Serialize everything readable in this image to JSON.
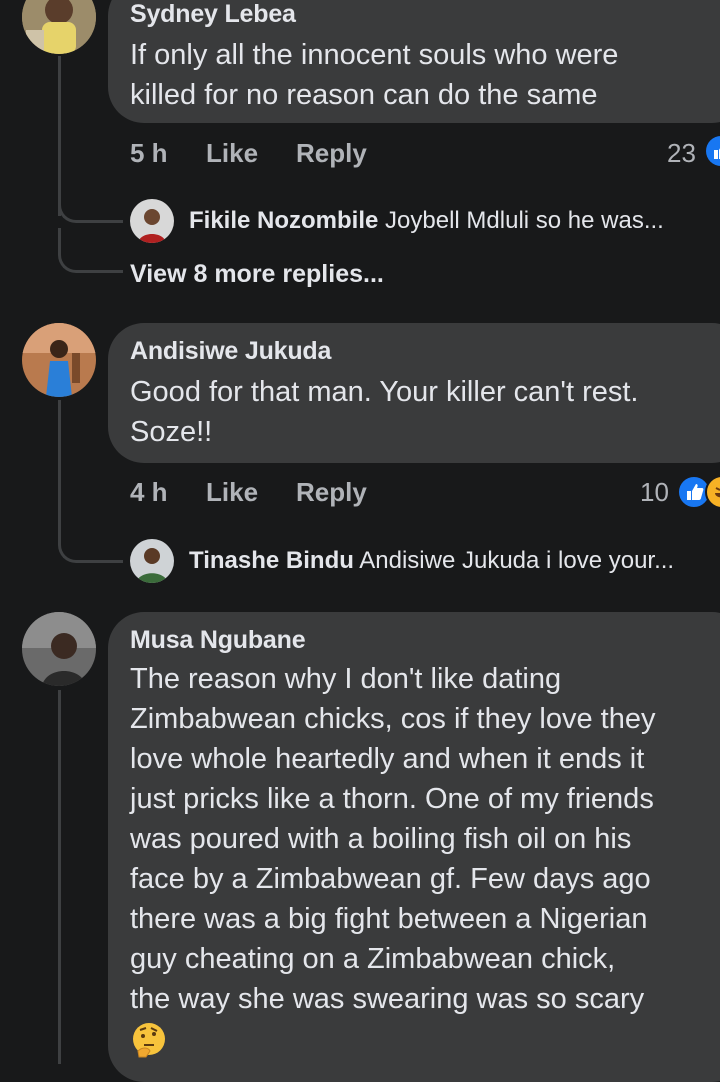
{
  "comments": [
    {
      "author": "Sydney Lebea",
      "text_lines": [
        "If only all the  innocent souls who were",
        "killed for no reason can do the same"
      ],
      "time": "5 h",
      "like_label": "Like",
      "reply_label": "Reply",
      "reaction_count": "23",
      "reply_preview": {
        "author": "Fikile Nozombile",
        "text": "Joybell Mdluli so he was..."
      },
      "more_replies": "View 8 more replies..."
    },
    {
      "author": "Andisiwe Jukuda",
      "text_lines": [
        "Good for that man. Your killer can't rest.",
        "Soze!!"
      ],
      "time": "4 h",
      "like_label": "Like",
      "reply_label": "Reply",
      "reaction_count": "10",
      "reply_preview": {
        "author": "Tinashe Bindu",
        "text": "Andisiwe Jukuda i love your..."
      }
    },
    {
      "author": "Musa Ngubane",
      "text_lines": [
        "The reason why I don't like dating",
        "Zimbabwean chicks, cos if they love they",
        "love whole heartedly and when it ends it",
        "just pricks like a thorn. One of my friends",
        "was poured with a boiling fish oil on his",
        "face by a Zimbabwean gf. Few days ago",
        "there was a big fight between a Nigerian",
        "guy cheating on a Zimbabwean chick,",
        "the way she was swearing was so scary"
      ],
      "emoji": "thinking-face"
    }
  ],
  "colors": {
    "background": "#18191a",
    "bubble": "#3a3b3c",
    "text": "#e4e6eb",
    "meta": "#b0b3b8",
    "like_blue": "#1877f2",
    "haha_yellow": "#f7b125"
  }
}
